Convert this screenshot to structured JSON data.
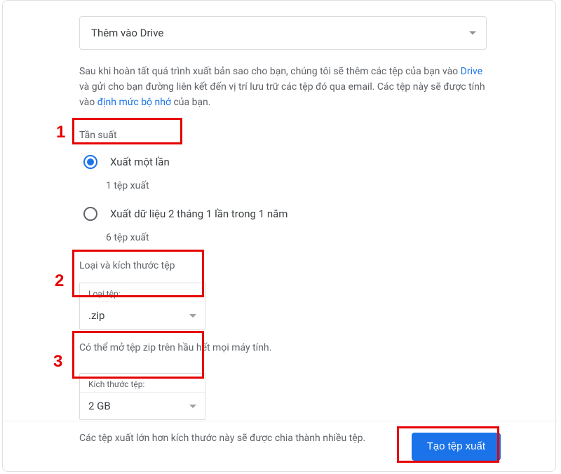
{
  "destination": {
    "selected": "Thêm vào Drive"
  },
  "description": {
    "pre": "Sau khi hoàn tất quá trình xuất bản sao cho bạn, chúng tôi sẽ thêm các tệp của bạn vào ",
    "link1": "Drive",
    "mid": " và gửi cho bạn đường liên kết đến vị trí lưu trữ các tệp đó qua email. Các tệp này sẽ được tính vào ",
    "link2": "định mức bộ nhớ",
    "post": " của bạn."
  },
  "frequency": {
    "label": "Tần suất",
    "option1": {
      "title": "Xuất một lần",
      "sub": "1 tệp xuất"
    },
    "option2": {
      "title": "Xuất dữ liệu 2 tháng 1 lần trong 1 năm",
      "sub": "6 tệp xuất"
    }
  },
  "filetypesize": {
    "label": "Loại và kích thước tệp",
    "filetype": {
      "label": "Loại tệp:",
      "value": ".zip",
      "helper": "Có thể mở tệp zip trên hầu hết mọi máy tính."
    },
    "filesize": {
      "label": "Kích thước tệp:",
      "value": "2 GB",
      "helper": "Các tệp xuất lớn hơn kích thước này sẽ được chia thành nhiều tệp."
    }
  },
  "actions": {
    "create": "Tạo tệp xuất"
  },
  "annotations": {
    "n1": "1",
    "n2": "2",
    "n3": "3"
  }
}
